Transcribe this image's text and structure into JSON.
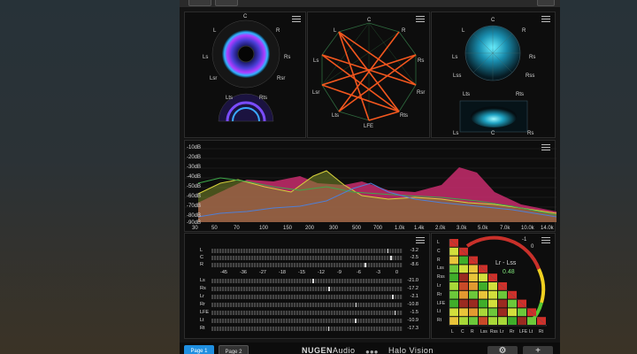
{
  "polar_panel": {
    "channels": [
      "C",
      "L",
      "R",
      "Ls",
      "Rs",
      "Lsr",
      "Rsr",
      "Lts",
      "Rts"
    ]
  },
  "graph_panel": {
    "channels": [
      "C",
      "L",
      "R",
      "Ls",
      "Rs",
      "Lsr",
      "Rsr",
      "Lts",
      "Rts",
      "LFE"
    ]
  },
  "vectorscope_panel": {
    "channels": [
      "C",
      "L",
      "R",
      "Ls",
      "Rs",
      "Lts",
      "Rts",
      "Lss",
      "Rss"
    ],
    "lower_channels": [
      "Lts",
      "Rts",
      "Ls",
      "C",
      "Rs"
    ]
  },
  "spectrum": {
    "db_labels": [
      "-10dB",
      "-20dB",
      "-30dB",
      "-40dB",
      "-50dB",
      "-60dB",
      "-70dB",
      "-80dB",
      "-90dB"
    ],
    "freq_labels": [
      "30",
      "50",
      "70",
      "100",
      "150",
      "200",
      "300",
      "500",
      "700",
      "1.0k",
      "1.4k",
      "2.0k",
      "3.0k",
      "5.0k",
      "7.0k",
      "10.0k",
      "14.0k"
    ],
    "colors": {
      "magenta": "#e0307a",
      "yellow": "#d8d23c",
      "green": "#3ea84a",
      "blue": "#4f7fd6"
    }
  },
  "meters": {
    "scale": [
      "-45",
      "-36",
      "-27",
      "-18",
      "-15",
      "-12",
      "-9",
      "-6",
      "-3",
      "0"
    ],
    "top_rows": [
      {
        "label": "L",
        "value": "-3.2"
      },
      {
        "label": "C",
        "value": "-2.5"
      },
      {
        "label": "R",
        "value": "-8.6"
      }
    ],
    "rows": [
      {
        "label": "Ls",
        "value": "-21.0"
      },
      {
        "label": "Rs",
        "value": "-17.2"
      },
      {
        "label": "Lr",
        "value": "-2.1"
      },
      {
        "label": "Rr",
        "value": "-10.8"
      },
      {
        "label": "LFE",
        "value": "-1.5"
      },
      {
        "label": "Lt",
        "value": "-10.9"
      },
      {
        "label": "Rt",
        "value": "-17.3"
      }
    ]
  },
  "correlation": {
    "pair_label": "Lr - Lss",
    "value": "0.48",
    "gauge_min": "-1",
    "gauge_max": "0",
    "row_labels": [
      "L",
      "C",
      "R",
      "Lss",
      "Rss",
      "Lr",
      "Rr",
      "LFE",
      "Lt",
      "Rt"
    ],
    "col_labels": [
      "L",
      "C",
      "R",
      "Lss",
      "Rss",
      "Lr",
      "Rr",
      "LFE",
      "Lt",
      "Rt"
    ]
  },
  "bottom": {
    "page1": "Page 1",
    "page2": "Page 2",
    "brand_a": "NUGEN",
    "brand_b": "Audio",
    "product": "Halo Vision",
    "settings_icon": "gear-icon",
    "add_icon": "plus-icon"
  }
}
